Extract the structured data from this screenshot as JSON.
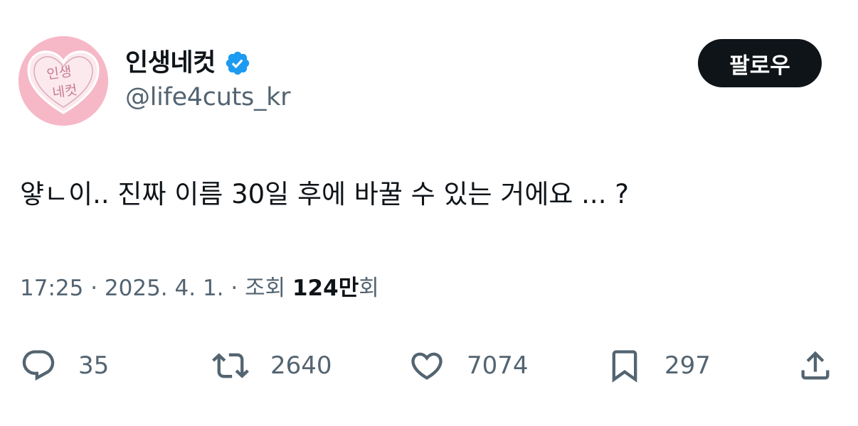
{
  "author": {
    "display_name": "인생네컷",
    "handle": "@life4cuts_kr",
    "avatar_text_line1": "인생",
    "avatar_text_line2": "네컷",
    "verified_icon": "verified-badge-icon"
  },
  "follow_button": {
    "label": "팔로우"
  },
  "tweet": {
    "text": "얗ㄴ이.. 진짜 이름 30일 후에 바꿀 수 있는 거에요 ... ?"
  },
  "meta": {
    "time": "17:25",
    "separator": " · ",
    "date": "2025. 4. 1.",
    "views_label": "조회 ",
    "views_count": "124만",
    "views_suffix": "회"
  },
  "actions": {
    "replies": {
      "icon": "reply-icon",
      "count": "35"
    },
    "retweets": {
      "icon": "retweet-icon",
      "count": "2640"
    },
    "likes": {
      "icon": "heart-icon",
      "count": "7074"
    },
    "bookmarks": {
      "icon": "bookmark-icon",
      "count": "297"
    },
    "share": {
      "icon": "share-icon"
    }
  },
  "colors": {
    "text_primary": "#0f1419",
    "text_secondary": "#536471",
    "verified_blue": "#1d9bf0",
    "follow_bg": "#0f1419",
    "avatar_pink": "#f6b8c7"
  }
}
